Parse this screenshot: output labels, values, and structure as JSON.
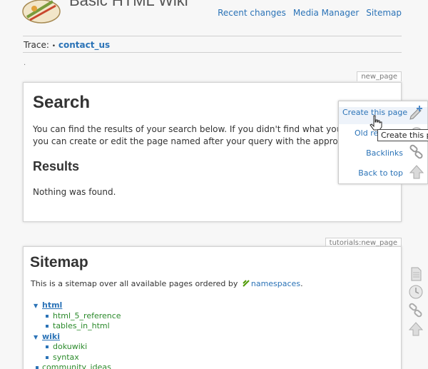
{
  "header": {
    "site_title": "Basic HTML Wiki",
    "nav": [
      "Recent changes",
      "Media Manager",
      "Sitemap"
    ]
  },
  "trace": {
    "label": "Trace:",
    "sep": "•",
    "item": "contact_us"
  },
  "dot": ".",
  "search_page": {
    "page_id": "new_page",
    "title": "Search",
    "intro_line1": "You can find the results of your search below. If you didn't find what you were",
    "intro_line2": "you can create or edit the page named after your query with the appropriate",
    "results_heading": "Results",
    "results_text": "Nothing was found."
  },
  "page_tools": {
    "create": "Create this page",
    "old": "Old re",
    "backlinks": "Backlinks",
    "top": "Back to top",
    "tooltip": "Create this pa"
  },
  "sitemap_page": {
    "page_id": "tutorials:new_page",
    "title": "Sitemap",
    "intro": "This is a sitemap over all available pages ordered by",
    "intro_link": "namespaces",
    "intro_end": ".",
    "tree": [
      {
        "ns": "html",
        "pages": [
          "html_5_reference",
          "tables_in_html"
        ]
      },
      {
        "ns": "wiki",
        "pages": [
          "dokuwiki",
          "syntax"
        ]
      }
    ],
    "last_item": "community_ideas"
  }
}
